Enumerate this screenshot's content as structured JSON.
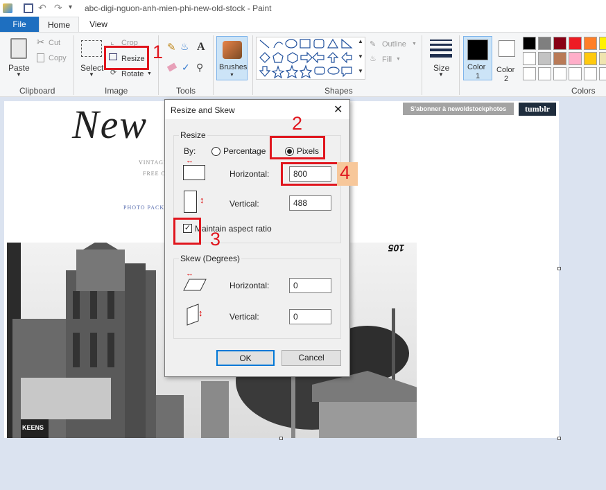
{
  "window": {
    "title": "abc-digi-nguon-anh-mien-phi-new-old-stock - Paint"
  },
  "tabs": [
    {
      "label": "File"
    },
    {
      "label": "Home"
    },
    {
      "label": "View"
    }
  ],
  "ribbon": {
    "clipboard": {
      "paste": "Paste",
      "cut": "Cut",
      "copy": "Copy",
      "group": "Clipboard"
    },
    "image": {
      "select": "Select",
      "crop": "Crop",
      "resize": "Resize",
      "rotate": "Rotate",
      "group": "Image"
    },
    "tools": {
      "group": "Tools"
    },
    "brushes": {
      "label": "Brushes"
    },
    "shapes": {
      "outline": "Outline",
      "fill": "Fill",
      "group": "Shapes"
    },
    "size": {
      "label": "Size"
    },
    "colors": {
      "color1": "Color",
      "color1_num": "1",
      "color2": "Color",
      "color2_num": "2",
      "group": "Colors",
      "palette": [
        "#000000",
        "#7f7f7f",
        "#880015",
        "#ed1c24",
        "#ff7f27",
        "#fff200",
        "#ffffff",
        "#c3c3c3",
        "#b97a57",
        "#ffaec9",
        "#ffc90e",
        "#efe4b0",
        "#ffffff",
        "#ffffff",
        "#ffffff",
        "#ffffff",
        "#ffffff",
        "#ffffff"
      ]
    }
  },
  "document": {
    "heading": "New",
    "vintage": "VINTAGE",
    "free": "FREE O",
    "photo_packs": "PHOTO PACKS",
    "subscribe": "S'abonner à newoldstockphotos",
    "tumblr": "tumblr",
    "plate_number": "105",
    "sign": "KEENS"
  },
  "dialog": {
    "title": "Resize and Skew",
    "resize_section": "Resize",
    "by": "By:",
    "percentage": "Percentage",
    "pixels": "Pixels",
    "horizontal_label": "Horizontal:",
    "horizontal_value": "800",
    "vertical_label": "Vertical:",
    "vertical_value": "488",
    "maintain": "Maintain aspect ratio",
    "skew_section": "Skew (Degrees)",
    "skew_h_label": "Horizontal:",
    "skew_h_value": "0",
    "skew_v_label": "Vertical:",
    "skew_v_value": "0",
    "ok": "OK",
    "cancel": "Cancel"
  },
  "annotations": [
    "1",
    "2",
    "3",
    "4"
  ],
  "colors": {
    "accent": "#1e6fc0",
    "annotation": "#e0161e"
  }
}
